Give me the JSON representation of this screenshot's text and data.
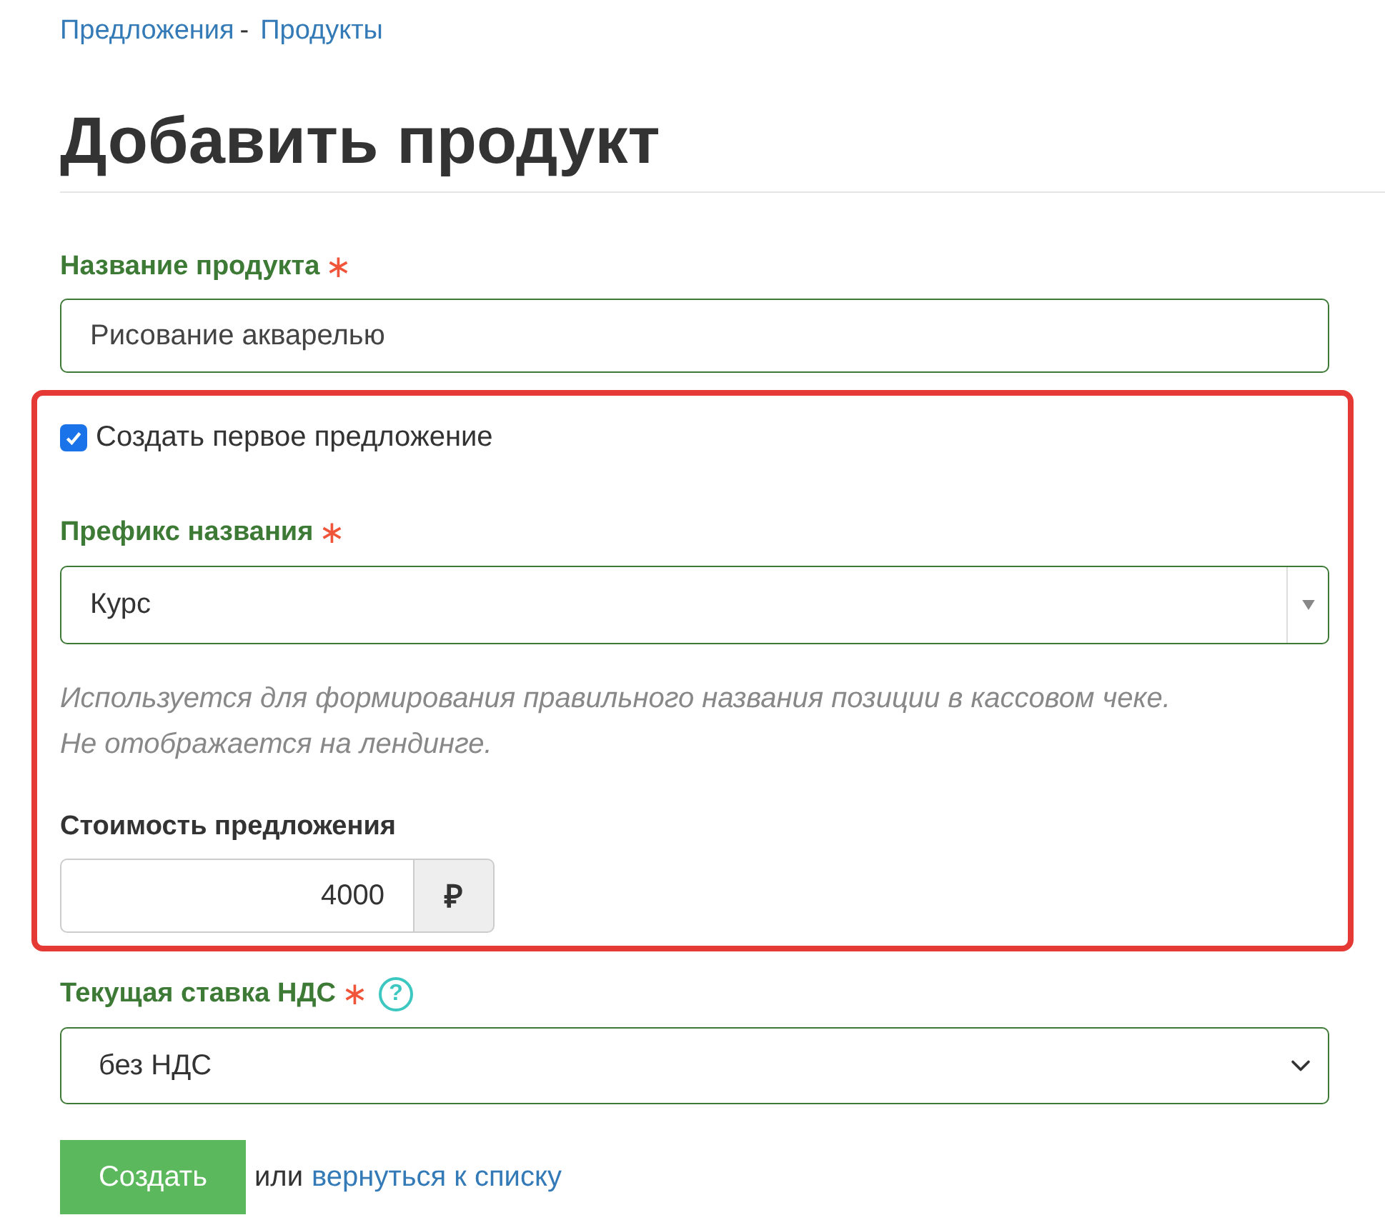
{
  "breadcrumbs": [
    {
      "label": "Предложения",
      "separator": "-"
    },
    {
      "label": "Продукты"
    }
  ],
  "title": "Добавить продукт",
  "required_mark": "∗",
  "product_name": {
    "label": "Название продукта",
    "required": true,
    "value": "Рисование акварелью"
  },
  "first_offer": {
    "label": "Создать первое предложение",
    "checked": true,
    "prefix": {
      "label": "Префикс названия",
      "required": true,
      "value": "Курс"
    },
    "hint": [
      "Используется для формирования правильного названия позиции в кассовом чеке.",
      "Не отображается на лендинге."
    ],
    "price": {
      "label": "Стоимость предложения",
      "value": "4000",
      "currency": "₽"
    }
  },
  "vat": {
    "label": "Текущая ставка НДС",
    "required": true,
    "help": "?",
    "value": "без НДС"
  },
  "actions": {
    "submit": "Создать",
    "or": "или",
    "back_link": "вернуться к списку"
  }
}
